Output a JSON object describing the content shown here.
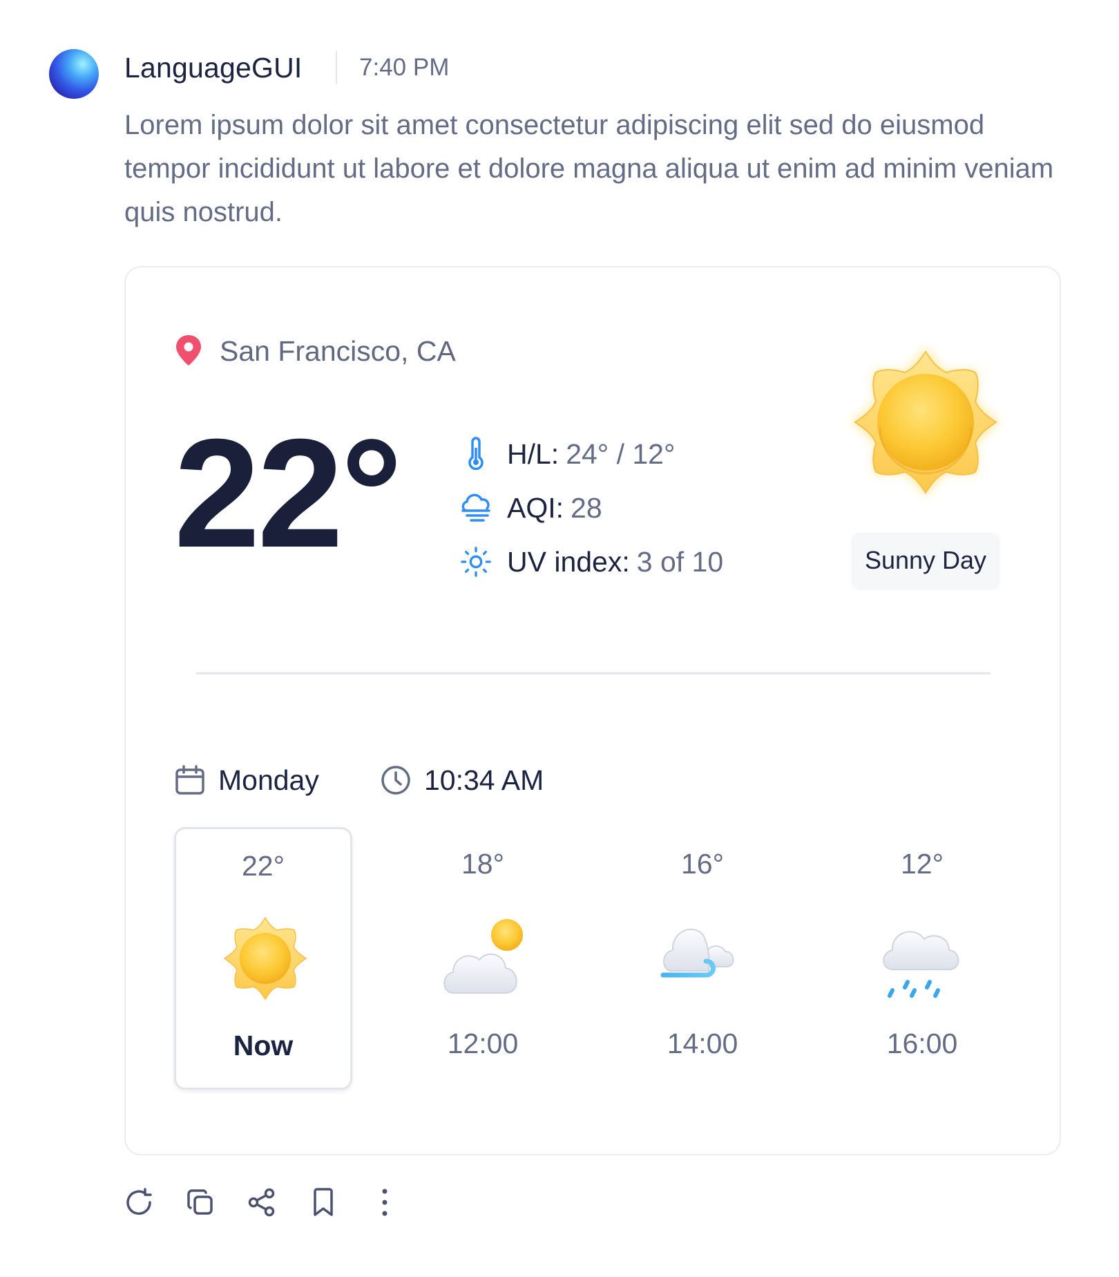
{
  "message": {
    "sender": "LanguageGUI",
    "time": "7:40 PM",
    "body": "Lorem ipsum dolor sit amet consectetur adipiscing elit sed do eiusmod tempor incididunt ut labore et dolore magna aliqua ut enim ad minim veniam quis nostrud."
  },
  "weather": {
    "location": "San Francisco, CA",
    "temperature": "22°",
    "stats": [
      {
        "icon": "thermometer-icon",
        "label": "H/L:",
        "value": "24° / 12°"
      },
      {
        "icon": "air-quality-icon",
        "label": "AQI:",
        "value": "28"
      },
      {
        "icon": "uv-sun-icon",
        "label": "UV index:",
        "value": "3 of 10"
      }
    ],
    "condition": "Sunny Day",
    "condition_icon": "sunny-icon",
    "day": "Monday",
    "clock": "10:34 AM",
    "hourly": [
      {
        "temp": "22°",
        "icon": "sunny-icon",
        "label": "Now",
        "active": true
      },
      {
        "temp": "18°",
        "icon": "partly-cloudy-icon",
        "label": "12:00"
      },
      {
        "temp": "16°",
        "icon": "windy-cloud-icon",
        "label": "14:00"
      },
      {
        "temp": "12°",
        "icon": "rain-cloud-icon",
        "label": "16:00"
      }
    ]
  },
  "actions": [
    "regenerate-icon",
    "copy-icon",
    "share-icon",
    "bookmark-icon",
    "more-icon"
  ],
  "colors": {
    "accent_blue": "#2f8ef5",
    "pin_red": "#f0506e",
    "sun_yellow": "#fcc934",
    "text_dark": "#1c2340",
    "text_muted": "#646c85"
  }
}
